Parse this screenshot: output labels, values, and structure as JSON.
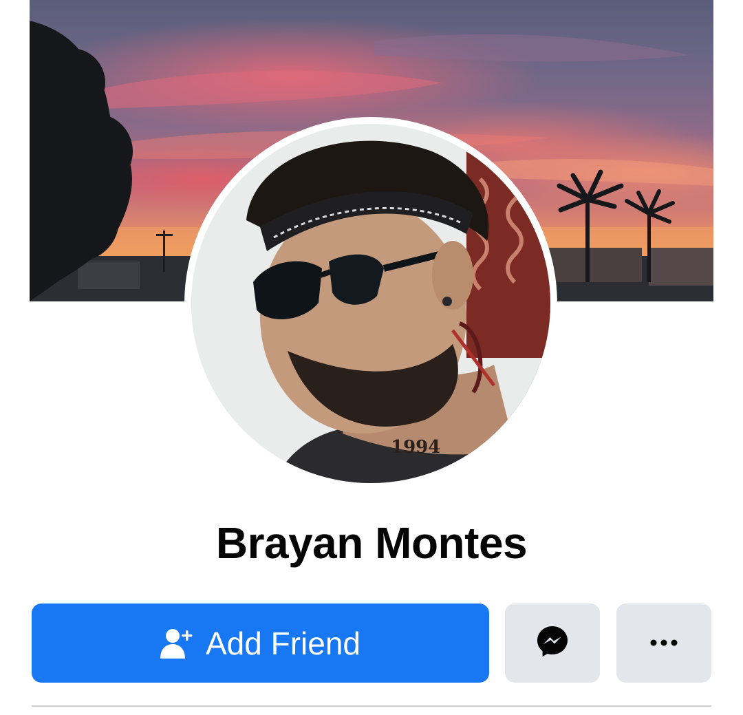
{
  "profile": {
    "name": "Brayan Montes"
  },
  "actions": {
    "add_friend_label": "Add Friend",
    "add_friend_icon": "person-add-icon",
    "message_icon": "messenger-icon",
    "more_icon": "more-dots-icon"
  },
  "colors": {
    "primary": "#1877f2",
    "secondary_button": "#e4e6eb",
    "text": "#050505"
  }
}
